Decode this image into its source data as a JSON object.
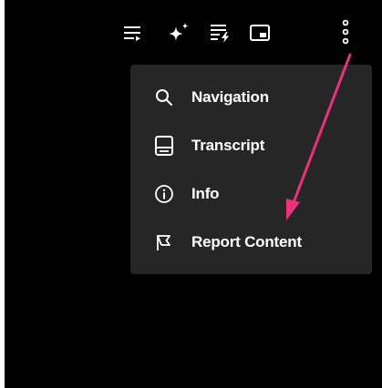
{
  "toolbar": {
    "icons": [
      "playlist-icon",
      "sparkle-icon",
      "quick-actions-icon",
      "picture-in-picture-icon",
      "more-options-icon"
    ]
  },
  "menu": {
    "items": [
      {
        "label": "Navigation",
        "icon": "search-icon"
      },
      {
        "label": "Transcript",
        "icon": "transcript-icon"
      },
      {
        "label": "Info",
        "icon": "info-icon"
      },
      {
        "label": "Report Content",
        "icon": "flag-icon"
      }
    ]
  },
  "colors": {
    "background": "#000000",
    "menu_background": "#262626",
    "text": "#ffffff",
    "annotation_arrow": "#e8327c"
  }
}
